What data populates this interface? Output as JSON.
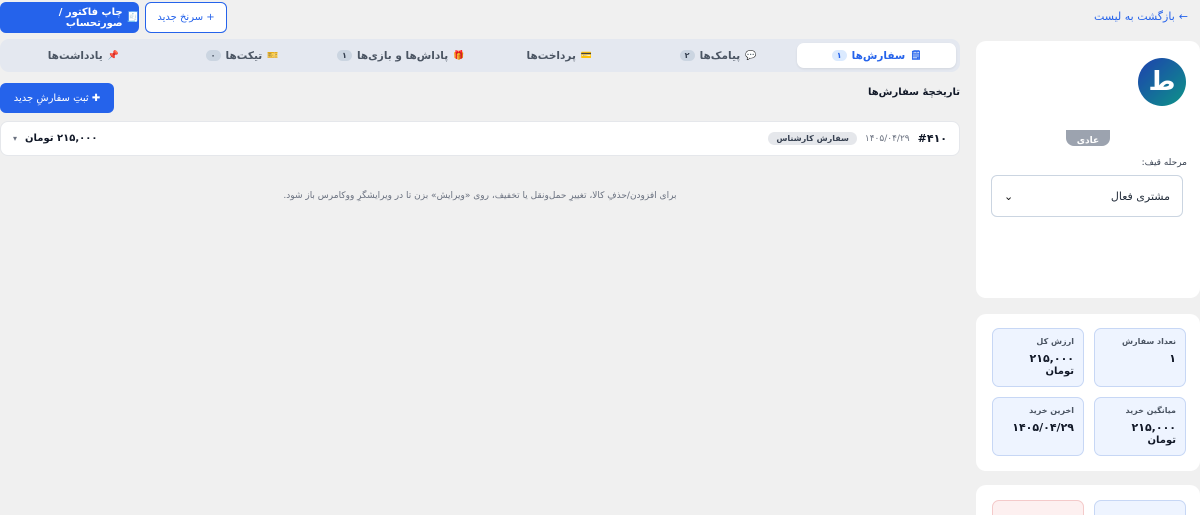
{
  "header": {
    "back_label": "بازگشت به لیست",
    "back_arrow": "←",
    "new_quote_label": "+ سرنخ جدید",
    "print_icon": "🧾",
    "print_label": "چاپ فاکتور / صورتحساب"
  },
  "profile": {
    "avatar_initial": "ط",
    "tier_badge": "عادی",
    "funnel_label": "مرحله قیف:",
    "funnel_value": "مشتری فعال",
    "funnel_chevron": "⌄"
  },
  "stats": [
    {
      "label": "نعداد سفارش",
      "value": "۱",
      "unit": ""
    },
    {
      "label": "ارزش کل",
      "value": "۲۱۵,۰۰۰",
      "unit": "تومان"
    },
    {
      "label": "میانگین خرید",
      "value": "۲۱۵,۰۰۰",
      "unit": "تومان"
    },
    {
      "label": "اخرین خرید",
      "value": "۱۴۰۵/۰۴/۲۹",
      "unit": ""
    }
  ],
  "tabs": [
    {
      "icon": "🗒",
      "label": "سفارش‌ها",
      "count": "۱",
      "active": true
    },
    {
      "icon": "💬",
      "label": "پیامک‌ها",
      "count": "۲",
      "active": false
    },
    {
      "icon": "💳",
      "label": "پرداخت‌ها",
      "count": "",
      "active": false
    },
    {
      "icon": "🎁",
      "label": "پاداش‌ها و بازی‌ها",
      "count": "۱",
      "active": false
    },
    {
      "icon": "🎫",
      "label": "تیکت‌ها",
      "count": "۰",
      "active": false
    },
    {
      "icon": "📌",
      "label": "یادداشت‌ها",
      "count": "",
      "active": false
    }
  ],
  "orders": {
    "title": "تاریخچهٔ سفارش‌ها",
    "new_order_label": "✚ ثبتِ سفارشِ جدید",
    "rows": [
      {
        "number": "#۴۱۰",
        "date": "۱۴۰۵/۰۴/۲۹",
        "status": "سفارش کارشناس",
        "amount": "۲۱۵,۰۰۰ تومان",
        "caret": "▾"
      }
    ],
    "hint": "برای افزودن/حذفِ کالا، تغییرِ حمل‌ونقل یا تخفیف، روی «ویرایش» بزن تا در ویرایشگرِ ووکامرس باز شود."
  },
  "colors": {
    "accent": "#2563eb",
    "page_bg": "#f0f0f0",
    "stat_bg": "#eef4ff"
  }
}
